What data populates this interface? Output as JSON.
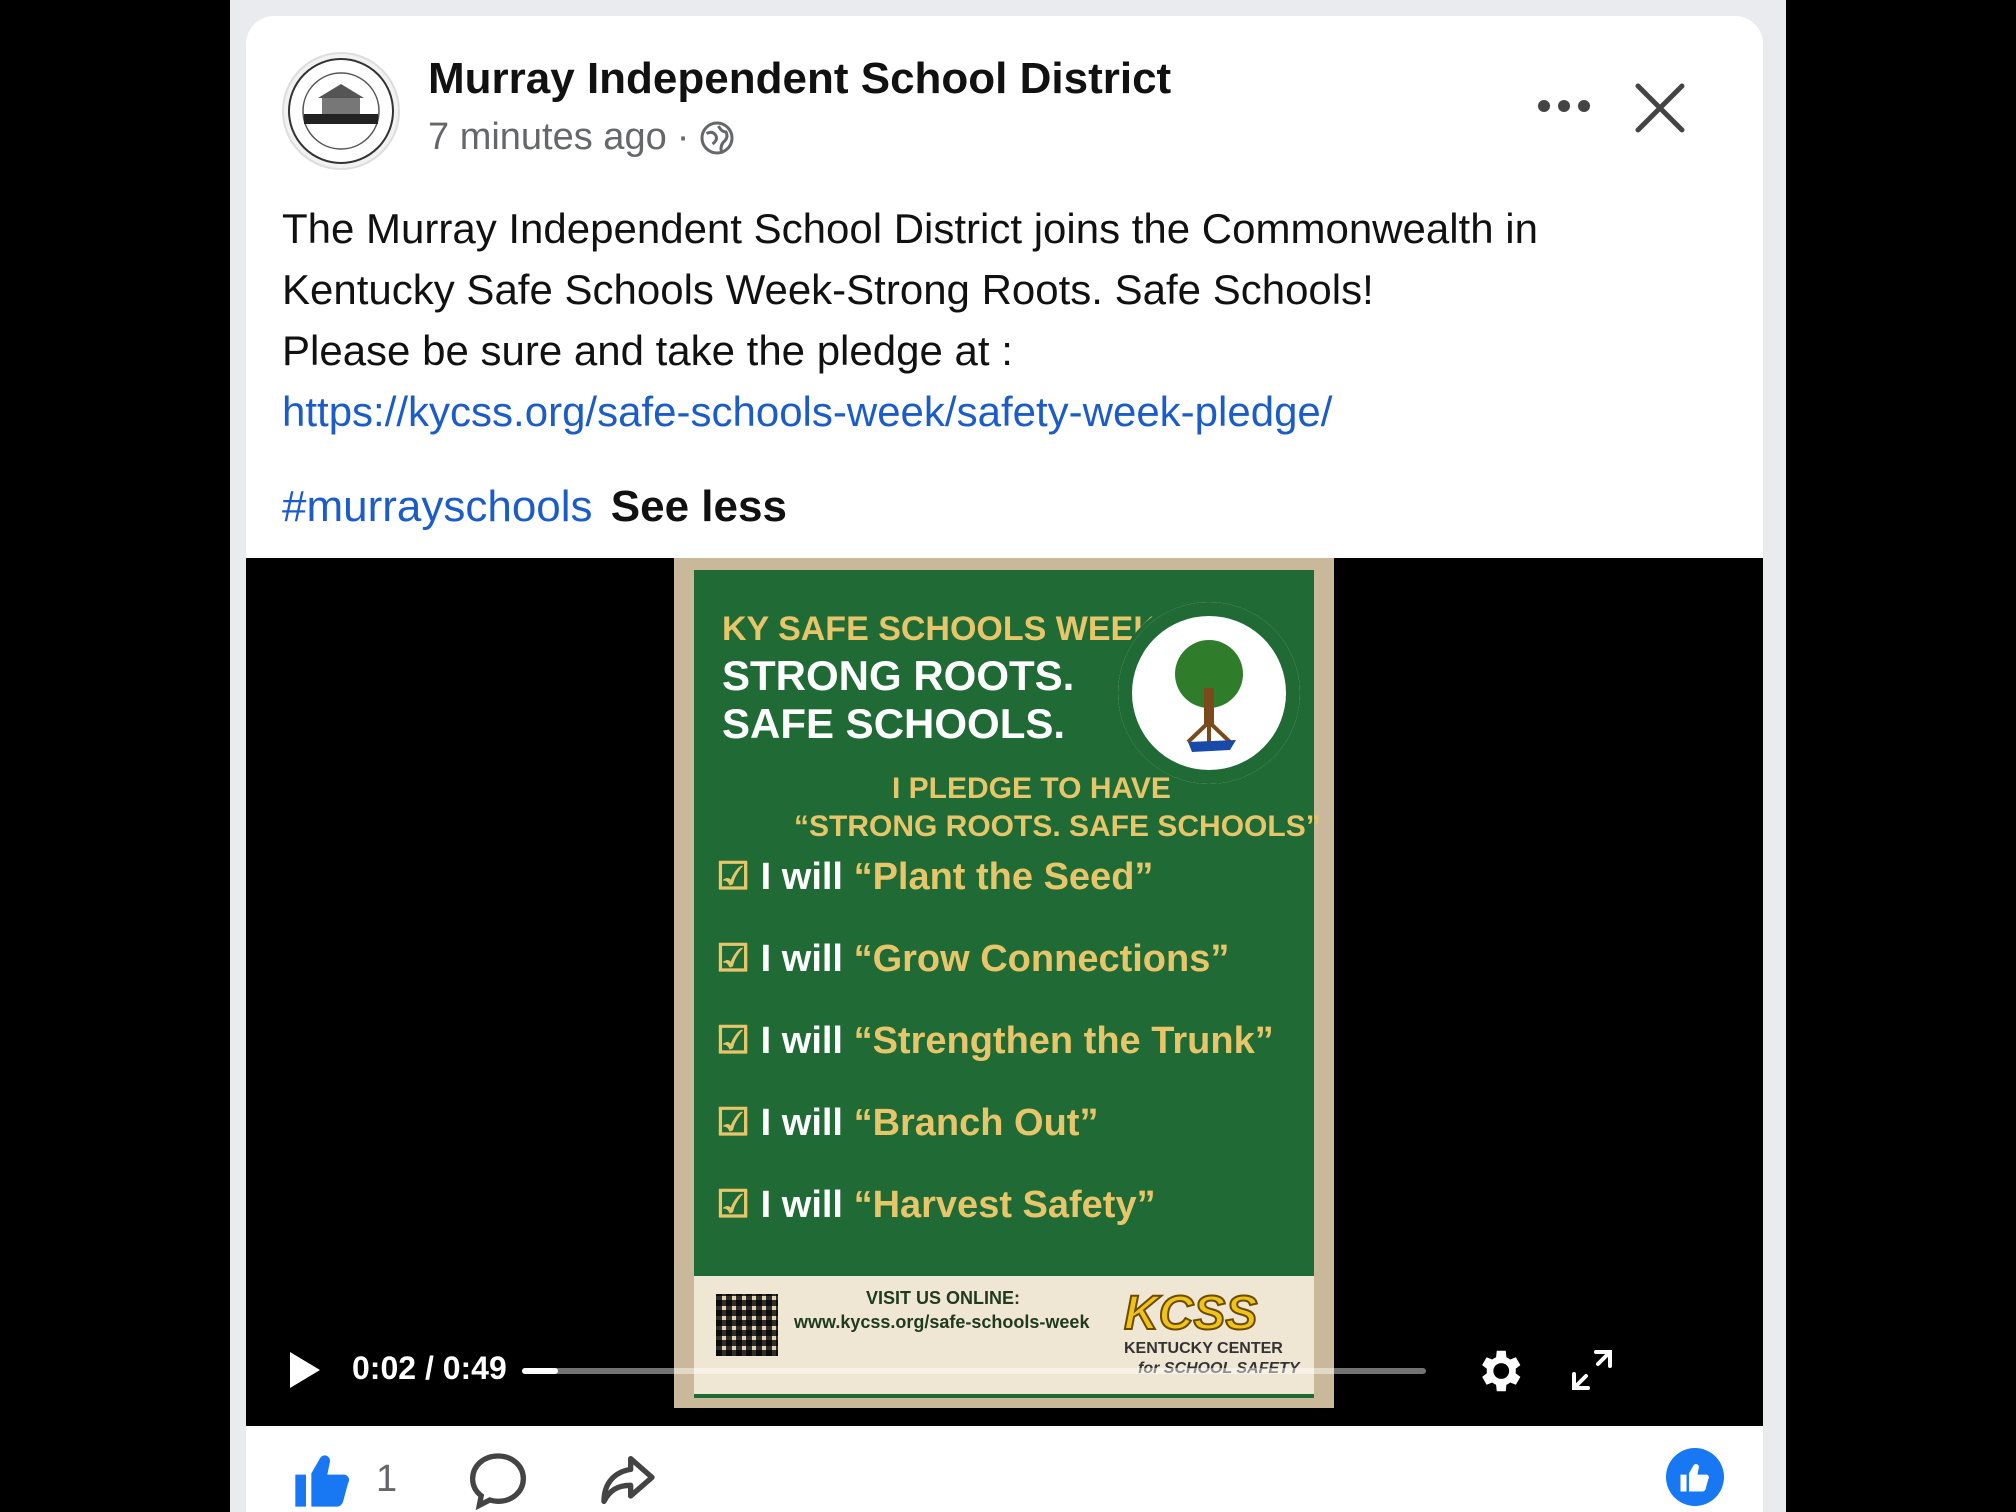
{
  "post": {
    "page_name": "Murray Independent School District",
    "time_ago": "7 minutes ago",
    "separator": "·",
    "text_line1": "The Murray Independent School District joins the Commonwealth in",
    "text_line2": "Kentucky Safe Schools Week-Strong Roots. Safe Schools!",
    "text_line3": "Please be sure and take the pledge at :",
    "link": "https://kycss.org/safe-schools-week/safety-week-pledge/",
    "hashtag": "#murrayschools",
    "see_less": "See less"
  },
  "poster": {
    "week_title": "KY SAFE SCHOOLS WEEK",
    "strong_roots": "STRONG ROOTS.",
    "safe_schools": "SAFE SCHOOLS.",
    "pledge_line1": "I PLEDGE TO HAVE",
    "pledge_line2": "“STRONG ROOTS. SAFE SCHOOLS”",
    "seal_text": "STRONG ROOTS. SAFE SCHOOLS",
    "pledges": [
      {
        "prefix": "I will",
        "phrase": "“Plant the Seed”"
      },
      {
        "prefix": "I will",
        "phrase": "“Grow Connections”"
      },
      {
        "prefix": "I will",
        "phrase": "“Strengthen the Trunk”"
      },
      {
        "prefix": "I will",
        "phrase": "“Branch Out”"
      },
      {
        "prefix": "I will",
        "phrase": "“Harvest Safety”"
      }
    ],
    "visit_label": "VISIT US ONLINE:",
    "visit_url": "www.kycss.org/safe-schools-week",
    "kcss_logo": "KCSS",
    "kcss_name": "KENTUCKY CENTER",
    "kcss_sub": "for SCHOOL SAFETY"
  },
  "video": {
    "time": "0:02 / 0:49",
    "progress_fraction": 0.04
  },
  "actions": {
    "like_count": "1"
  },
  "colors": {
    "link": "#1b5cc8",
    "poster_green": "#1f6a35",
    "poster_gold": "#e7c56a",
    "react_blue": "#1877f2"
  }
}
